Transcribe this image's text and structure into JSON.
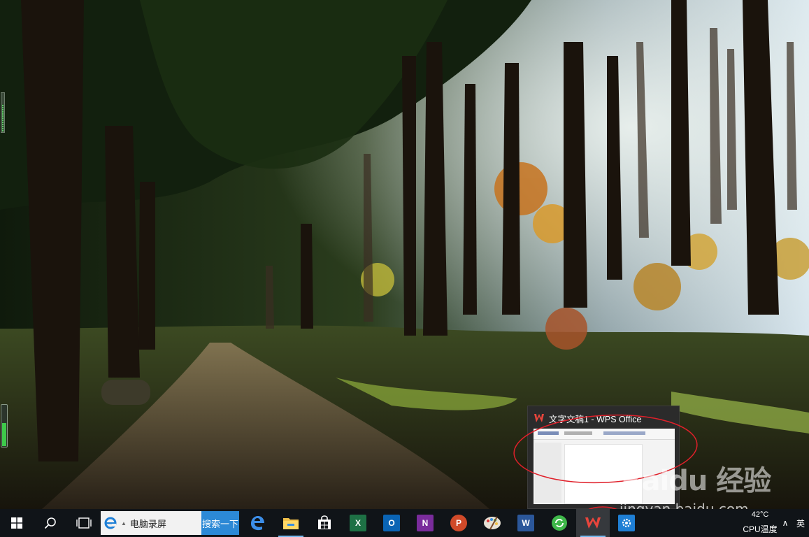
{
  "desktop": {
    "wallpaper": "forest-path-wallpaper"
  },
  "preview": {
    "app_icon": "wps-office-icon",
    "title": "文字文稿1 - WPS Office"
  },
  "watermark": {
    "logo": "Baidu 经验",
    "url": "jingyan.baidu.com"
  },
  "taskbar": {
    "start_icon": "windows-start-icon",
    "search_icon": "search-icon",
    "task_view_icon": "task-view-icon",
    "search_box_text": "电脑录屏",
    "search_button": "搜索一下",
    "apps": [
      {
        "name": "edge",
        "icon": "edge-icon"
      },
      {
        "name": "file-explorer",
        "icon": "folder-icon"
      },
      {
        "name": "store",
        "icon": "store-icon"
      },
      {
        "name": "excel",
        "icon": "excel-icon"
      },
      {
        "name": "outlook",
        "icon": "outlook-icon"
      },
      {
        "name": "onenote",
        "icon": "onenote-icon"
      },
      {
        "name": "powerpoint",
        "icon": "powerpoint-icon"
      },
      {
        "name": "paint",
        "icon": "paint-palette-icon"
      },
      {
        "name": "word",
        "icon": "word-icon"
      },
      {
        "name": "green-app",
        "icon": "refresh-circle-icon"
      },
      {
        "name": "wps",
        "icon": "wps-office-icon"
      },
      {
        "name": "settings",
        "icon": "gear-icon"
      }
    ],
    "tray": {
      "cpu_temp": "42°C",
      "cpu_label": "CPU温度",
      "chevron": "∧",
      "ime": "英"
    }
  },
  "colors": {
    "taskbar": "#101418",
    "accent": "#2c89d6",
    "annotation": "#e0202a"
  }
}
